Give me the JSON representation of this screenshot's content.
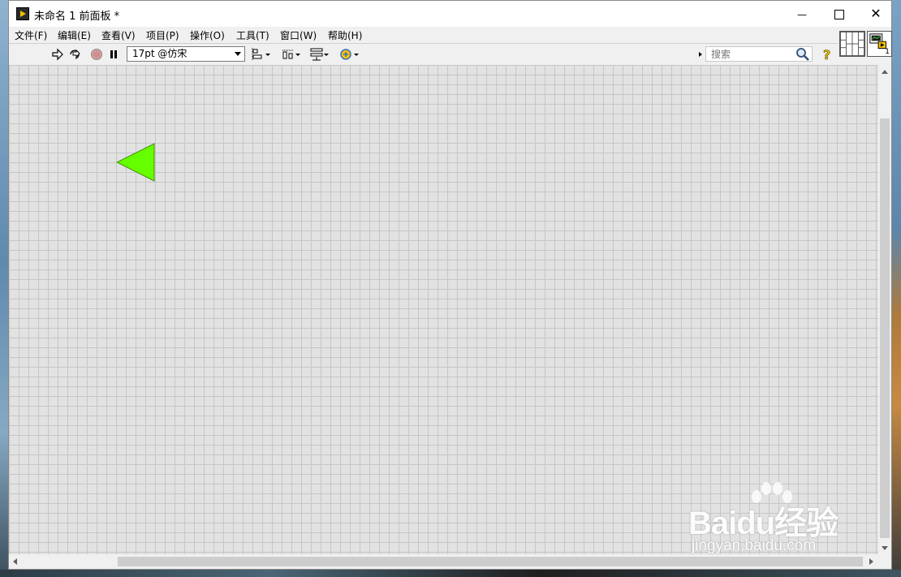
{
  "window": {
    "title": "未命名 1 前面板 *",
    "controls": {
      "minimize": "—",
      "close": "✕"
    }
  },
  "menu": [
    {
      "label": "文件(F)"
    },
    {
      "label": "编辑(E)"
    },
    {
      "label": "查看(V)"
    },
    {
      "label": "项目(P)"
    },
    {
      "label": "操作(O)"
    },
    {
      "label": "工具(T)"
    },
    {
      "label": "窗口(W)"
    },
    {
      "label": "帮助(H)"
    }
  ],
  "toolbar": {
    "font_setting": "17pt @仿宋",
    "search_placeholder": "搜索"
  },
  "vi_icon": {
    "number": "1"
  },
  "front_panel": {
    "indicator_color": "#66ff00"
  },
  "watermark": {
    "brand": "Baidu经验",
    "url": "jingyan.baidu.com"
  }
}
